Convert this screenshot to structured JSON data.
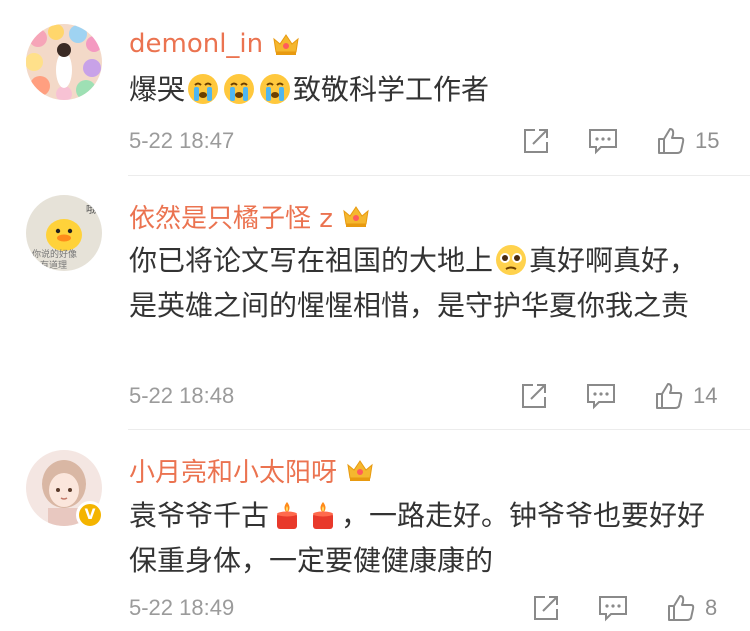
{
  "comments": [
    {
      "username": "demonl_in",
      "text_parts": [
        "爆哭",
        "致敬科学工作者"
      ],
      "time": "5-22 18:47",
      "likes": "15",
      "emoji": [
        "crying-face",
        "crying-face",
        "crying-face"
      ]
    },
    {
      "username": "依然是只橘子怪 z",
      "text_parts": [
        "你已将论文写在祖国的大地上",
        "真好啊真好，是英雄之间的惺惺相惜，是守护华夏你我之责"
      ],
      "time": "5-22 18:48",
      "likes": "14",
      "emoji": [
        "pleading-face"
      ],
      "avatar_text": [
        "哦",
        "你说的好像",
        "有道理"
      ]
    },
    {
      "username": "小月亮和小太阳呀",
      "text_parts": [
        "袁爷爷千古",
        "，一路走好。钟爷爷也要好好保重身体，一定要健健康康的"
      ],
      "time": "5-22 18:49",
      "likes": "8",
      "emoji": [
        "candle",
        "candle"
      ],
      "verified_badge": "V"
    }
  ],
  "colors": {
    "username": "#eb7350",
    "text": "#333333",
    "meta": "#9b9b9b",
    "crown": "#f5b72e",
    "badge": "#f4b400"
  },
  "icons": [
    "vip-crown-icon",
    "share-icon",
    "comment-icon",
    "like-icon"
  ]
}
